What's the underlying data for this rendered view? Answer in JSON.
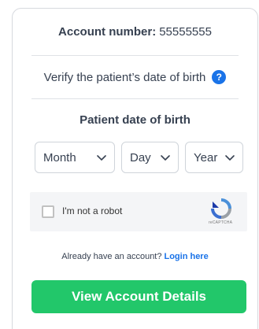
{
  "account": {
    "label": "Account number:",
    "value": "55555555"
  },
  "verify": {
    "text": "Verify the patient’s date of birth",
    "help_icon": "?"
  },
  "dob": {
    "title": "Patient date of birth",
    "month_placeholder": "Month",
    "day_placeholder": "Day",
    "year_placeholder": "Year"
  },
  "captcha": {
    "label": "I'm not a robot",
    "brand": "reCAPTCHA",
    "icon": "recaptcha-logo-icon"
  },
  "login": {
    "prompt": "Already have an account?",
    "link": "Login here"
  },
  "cta": {
    "label": "View Account Details"
  },
  "colors": {
    "accent_green": "#22c76a",
    "link_blue": "#1a73e8",
    "text": "#374151",
    "border": "#d6d9de"
  }
}
